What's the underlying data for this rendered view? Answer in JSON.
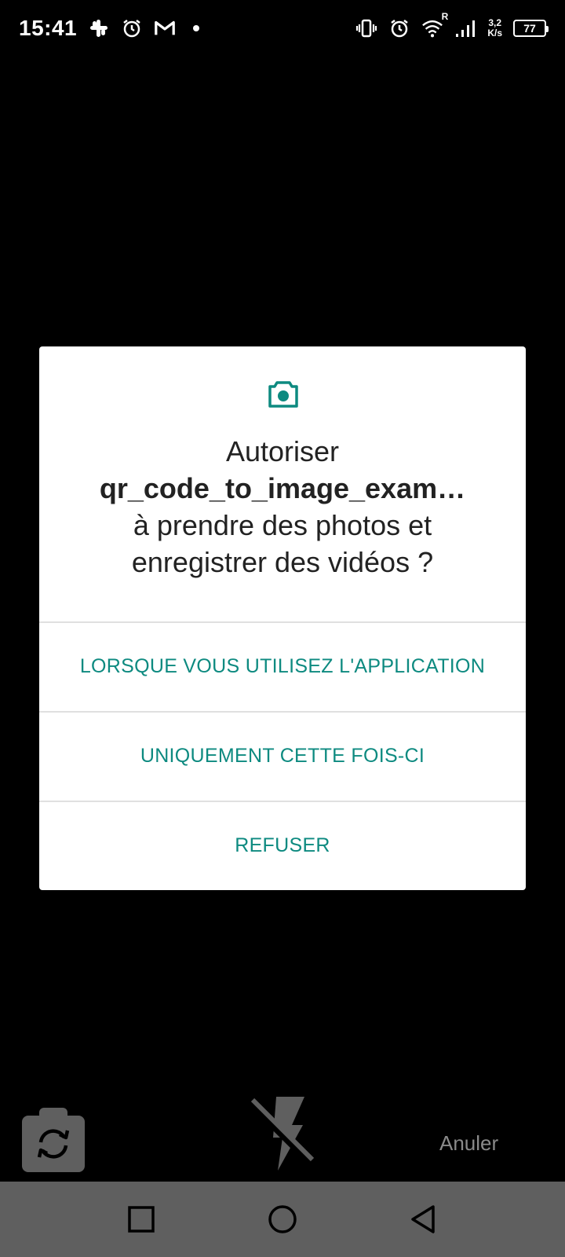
{
  "status_bar": {
    "time": "15:41",
    "icons_left": [
      "slack-icon",
      "alarm-icon",
      "gmail-icon",
      "notification-dot"
    ],
    "icons_right": [
      "vibrate-icon",
      "alarm-icon",
      "wifi-icon",
      "signal-icon"
    ],
    "roaming": "R",
    "speed_value": "3,2",
    "speed_unit": "K/s",
    "battery": "77"
  },
  "dialog": {
    "icon": "camera-icon",
    "title_line1": "Autoriser",
    "app_name": "qr_code_to_image_exam…",
    "title_rest": "à prendre des photos et enregistrer des vidéos ?",
    "buttons": [
      {
        "label": "LORSQUE VOUS UTILISEZ L'APPLICATION"
      },
      {
        "label": "UNIQUEMENT CETTE FOIS-CI"
      },
      {
        "label": "REFUSER"
      }
    ],
    "accent_color": "#0d8a80"
  },
  "camera_controls": {
    "switch_camera_icon": "switch-camera-icon",
    "flash_icon": "flash-off-icon",
    "cancel_label": "Anuler"
  },
  "nav_bar": {
    "buttons": [
      "recents-icon",
      "home-icon",
      "back-icon"
    ]
  }
}
